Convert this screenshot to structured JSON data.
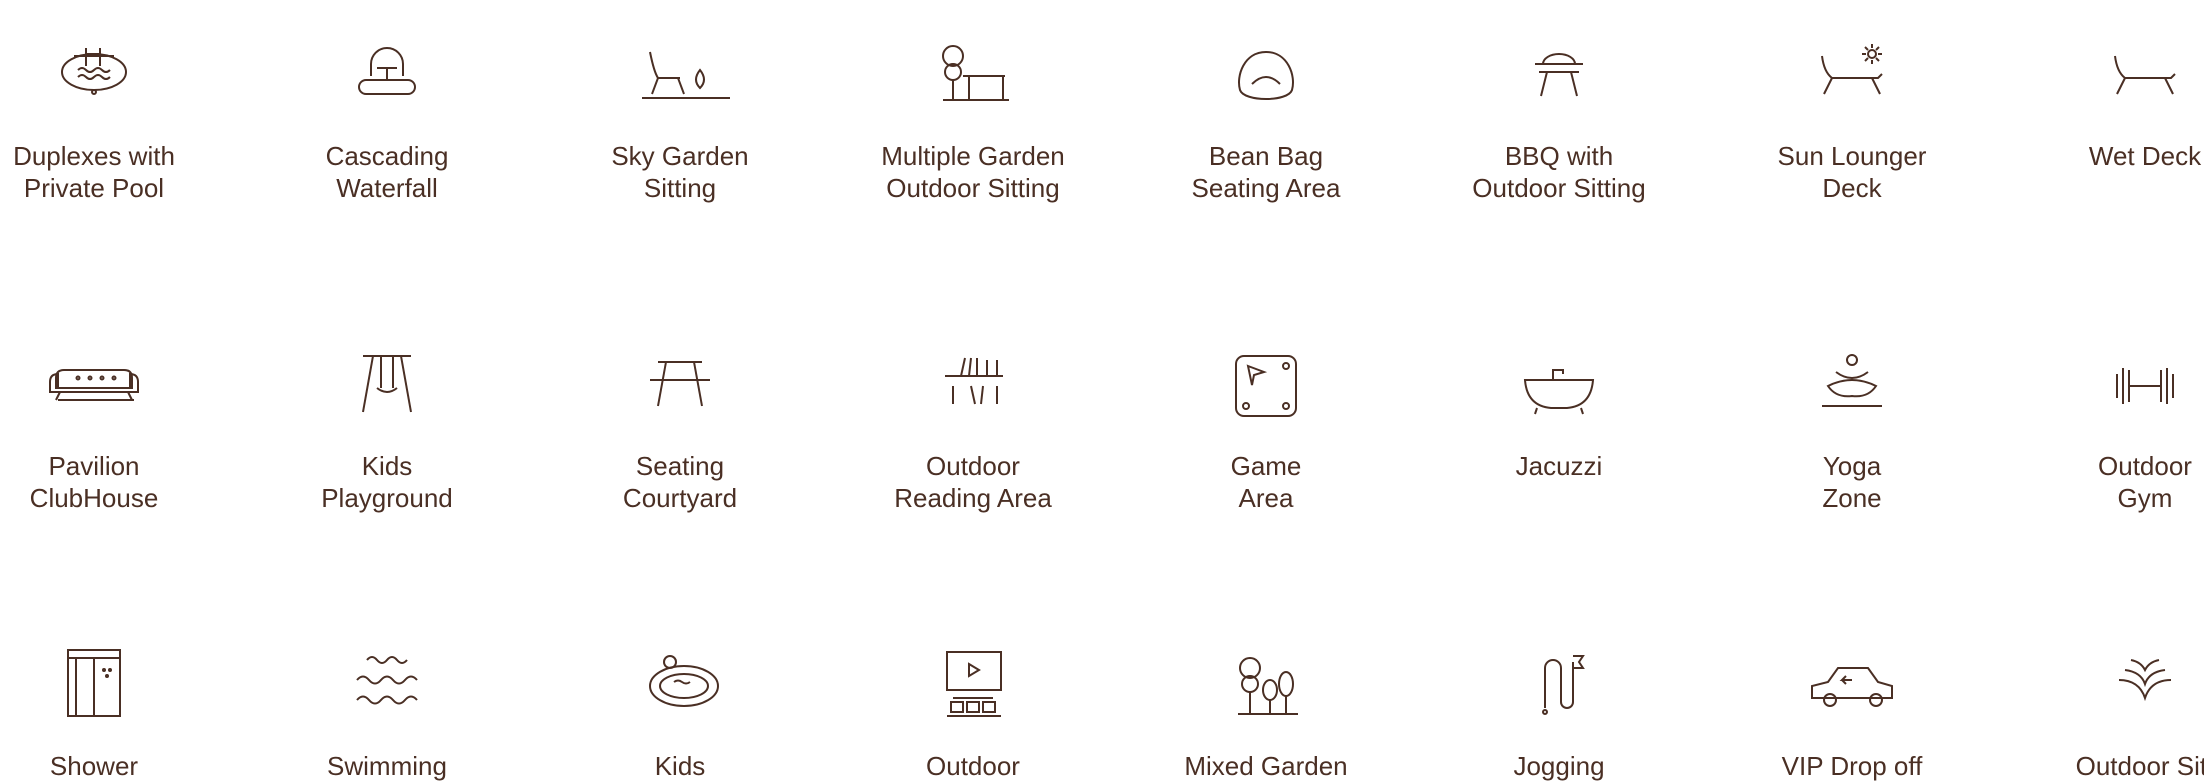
{
  "amenities": {
    "row1": [
      {
        "line1": "Duplexes with",
        "line2": "Private Pool",
        "icon": "pool-icon"
      },
      {
        "line1": "Cascading",
        "line2": "Waterfall",
        "icon": "waterfall-icon"
      },
      {
        "line1": "Sky Garden",
        "line2": "Sitting",
        "icon": "sky-garden-icon"
      },
      {
        "line1": "Multiple Garden",
        "line2": "Outdoor Sitting",
        "icon": "garden-sitting-icon"
      },
      {
        "line1": "Bean Bag",
        "line2": "Seating Area",
        "icon": "bean-bag-icon"
      },
      {
        "line1": "BBQ with",
        "line2": "Outdoor Sitting",
        "icon": "bbq-icon"
      },
      {
        "line1": "Sun Lounger",
        "line2": "Deck",
        "icon": "sun-lounger-icon"
      },
      {
        "line1": "Wet Deck",
        "line2": "",
        "icon": "wet-deck-icon"
      }
    ],
    "row2": [
      {
        "line1": "Pavilion",
        "line2": "ClubHouse",
        "icon": "sofa-icon"
      },
      {
        "line1": "Kids",
        "line2": "Playground",
        "icon": "swing-icon"
      },
      {
        "line1": "Seating",
        "line2": "Courtyard",
        "icon": "table-icon"
      },
      {
        "line1": "Outdoor",
        "line2": "Reading Area",
        "icon": "bookshelf-icon"
      },
      {
        "line1": "Game",
        "line2": "Area",
        "icon": "game-board-icon"
      },
      {
        "line1": "Jacuzzi",
        "line2": "",
        "icon": "bathtub-icon"
      },
      {
        "line1": "Yoga",
        "line2": "Zone",
        "icon": "yoga-icon"
      },
      {
        "line1": "Outdoor",
        "line2": "Gym",
        "icon": "dumbbell-icon"
      }
    ],
    "row3": [
      {
        "line1": "Shower",
        "line2": "",
        "icon": "shower-icon"
      },
      {
        "line1": "Swimming",
        "line2": "",
        "icon": "waves-icon"
      },
      {
        "line1": "Kids",
        "line2": "",
        "icon": "kids-pool-icon"
      },
      {
        "line1": "Outdoor",
        "line2": "",
        "icon": "outdoor-theatre-icon"
      },
      {
        "line1": "Mixed Garden",
        "line2": "",
        "icon": "trees-icon"
      },
      {
        "line1": "Jogging",
        "line2": "",
        "icon": "jogging-track-icon"
      },
      {
        "line1": "VIP Drop off",
        "line2": "",
        "icon": "car-icon"
      },
      {
        "line1": "Outdoor Sitt",
        "line2": "",
        "icon": "chevron-sitting-icon"
      }
    ]
  },
  "colors": {
    "ink": "#4a2f24",
    "background": "#ffffff"
  }
}
